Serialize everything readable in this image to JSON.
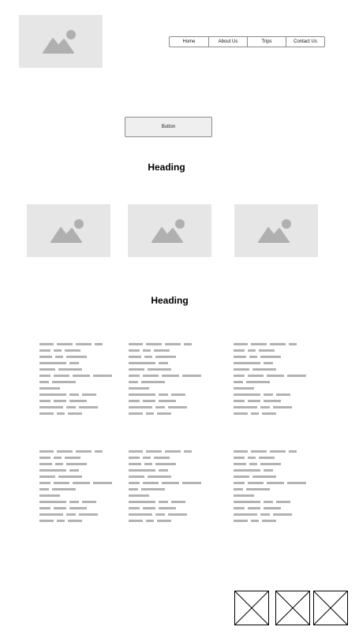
{
  "header": {
    "logo": {
      "icon": "image-placeholder-icon"
    },
    "nav": [
      "Home",
      "About Us",
      "Trips",
      "Contact Us"
    ]
  },
  "hero": {
    "button_label": "Button"
  },
  "section1": {
    "heading": "Heading",
    "images": [
      {
        "icon": "image-placeholder-icon"
      },
      {
        "icon": "image-placeholder-icon"
      },
      {
        "icon": "image-placeholder-icon"
      }
    ]
  },
  "section2": {
    "heading": "Heading",
    "text_blocks": 6
  },
  "footer": {
    "icons": [
      "x-placeholder-icon",
      "x-placeholder-icon",
      "x-placeholder-icon"
    ]
  },
  "colors": {
    "placeholder_bg": "#e6e6e6",
    "placeholder_icon": "#b0b0b0",
    "text_line": "#b3b3b3"
  }
}
